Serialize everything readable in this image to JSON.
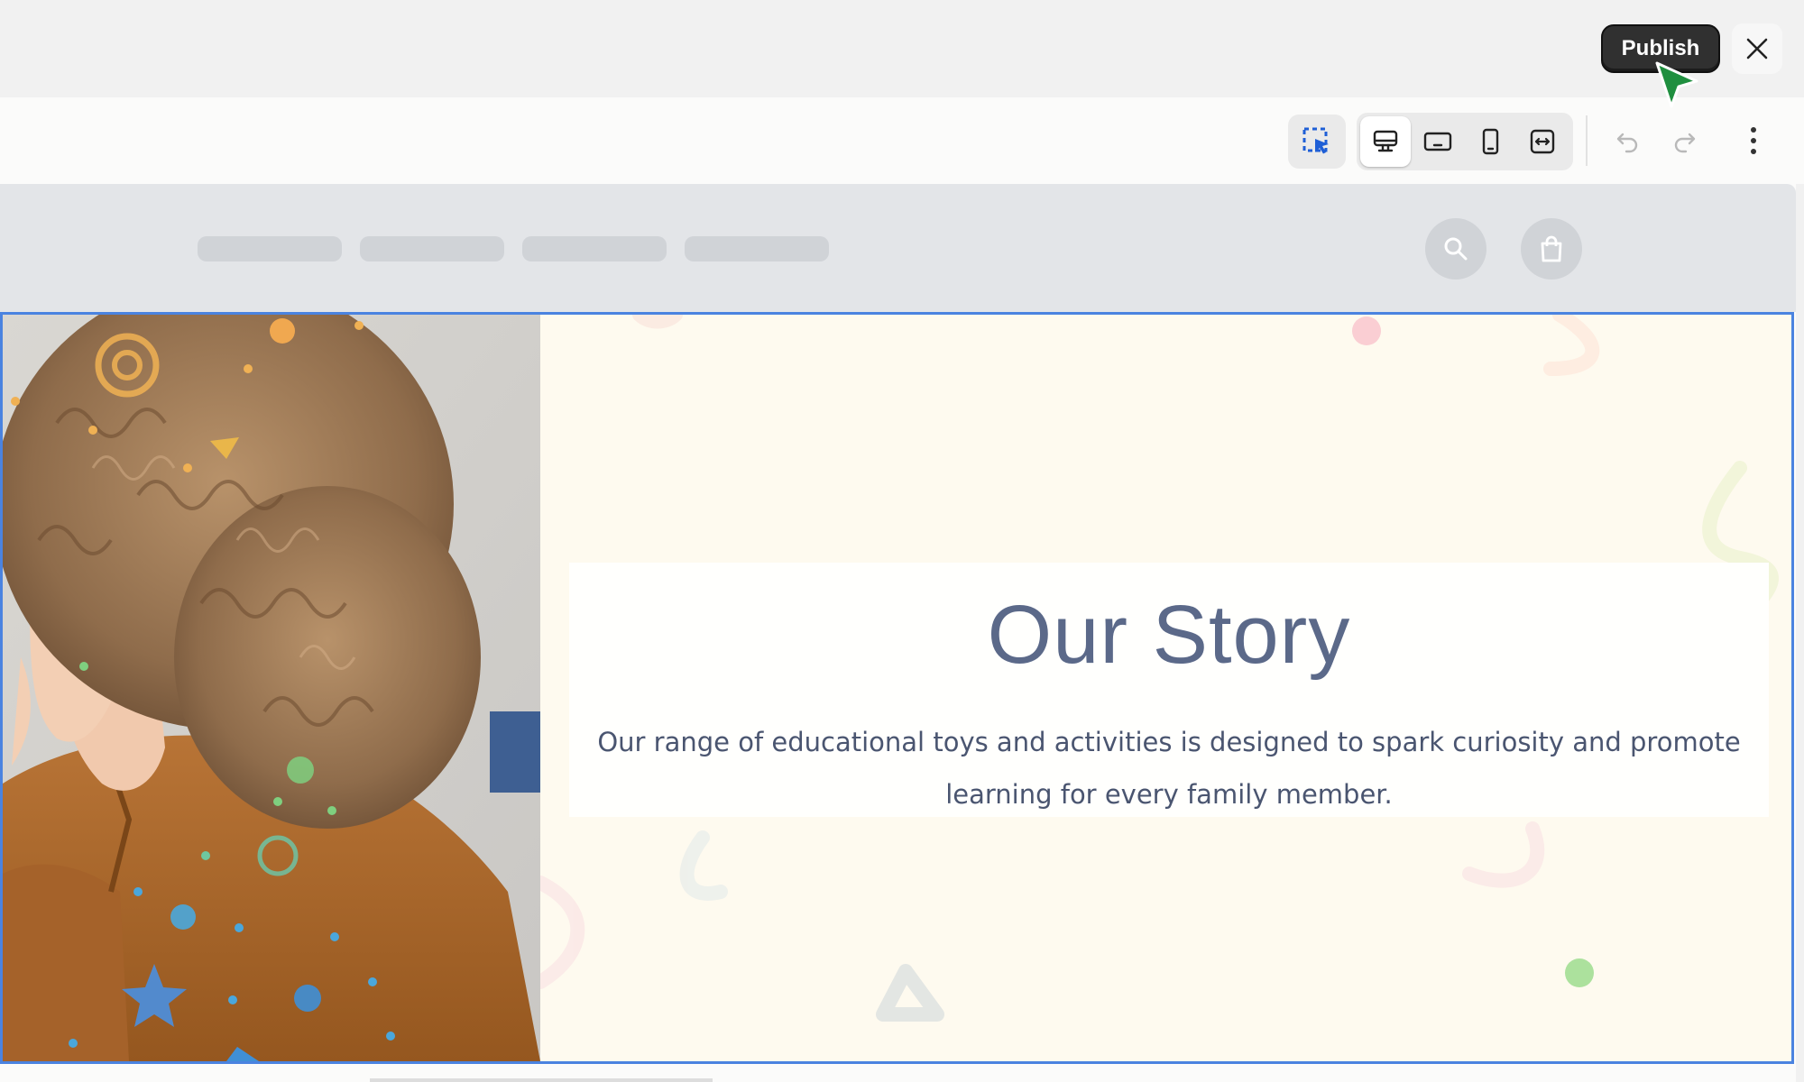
{
  "topbar": {
    "publish_label": "Publish",
    "close_icon": "close-icon"
  },
  "toolbar": {
    "select_tool_icon": "selection-cursor-icon",
    "views": [
      {
        "icon": "desktop-icon",
        "active": true
      },
      {
        "icon": "tablet-landscape-icon",
        "active": false
      },
      {
        "icon": "mobile-icon",
        "active": false
      },
      {
        "icon": "full-width-icon",
        "active": false
      }
    ],
    "undo_icon": "undo-icon",
    "redo_icon": "redo-icon",
    "more_icon": "more-vertical-icon"
  },
  "site_header": {
    "search_icon": "search-icon",
    "cart_icon": "shopping-bag-icon"
  },
  "section": {
    "title": "Our Story",
    "description": "Our range of educational toys and activities is designed to spark curiosity and promote learning for every family member."
  },
  "colors": {
    "selection_border": "#4a83e0",
    "section_bg": "#fefaef",
    "publish_bg": "#303030",
    "title_color": "#5b6989"
  }
}
